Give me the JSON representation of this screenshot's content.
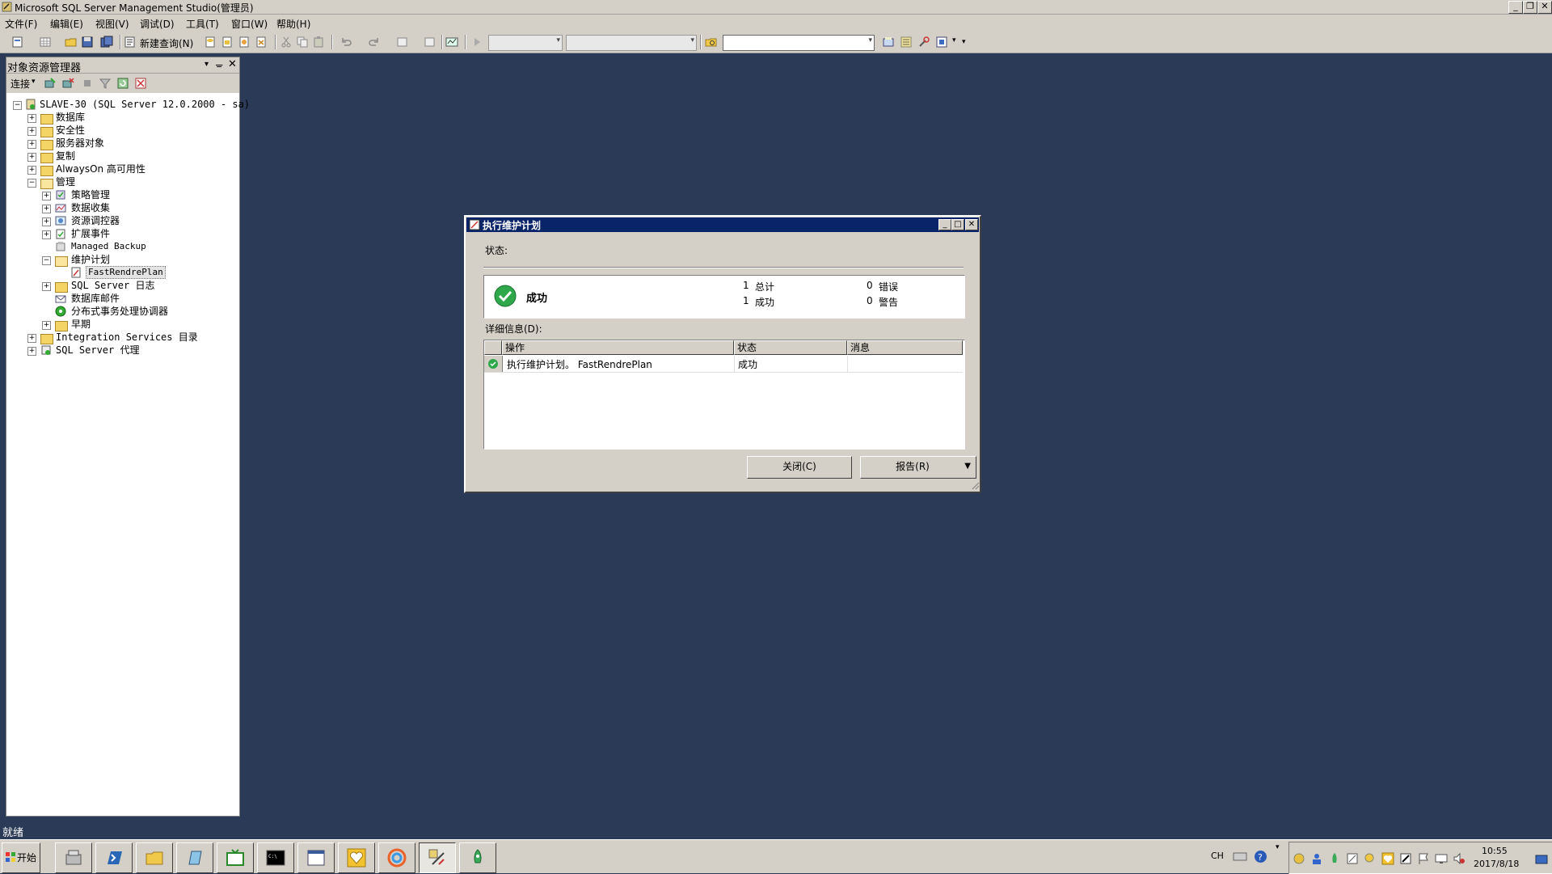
{
  "window": {
    "title": "Microsoft SQL Server Management Studio(管理员)"
  },
  "menu": [
    "文件(F)",
    "编辑(E)",
    "视图(V)",
    "调试(D)",
    "工具(T)",
    "窗口(W)",
    "帮助(H)"
  ],
  "toolbar": {
    "new_query": "新建查询(N)"
  },
  "object_explorer": {
    "title": "对象资源管理器",
    "connect": "连接",
    "server": "SLAVE-30 (SQL Server 12.0.2000 - sa)",
    "nodes": {
      "databases": "数据库",
      "security": "安全性",
      "server_objects": "服务器对象",
      "replication": "复制",
      "alwayson": "AlwaysOn 高可用性",
      "management": "管理",
      "policy": "策略管理",
      "data_collection": "数据收集",
      "resource_governor": "资源调控器",
      "extended_events": "扩展事件",
      "managed_backup": "Managed Backup",
      "maintenance_plans": "维护计划",
      "fastrendreplan": "FastRendrePlan",
      "sql_logs": "SQL Server 日志",
      "db_mail": "数据库邮件",
      "dtc": "分布式事务处理协调器",
      "legacy": "早期",
      "integration_services": "Integration Services 目录",
      "sql_agent": "SQL Server 代理"
    }
  },
  "status_bar": {
    "text": "就绪"
  },
  "dialog": {
    "title": "执行维护计划",
    "status_label": "状态:",
    "result_text": "成功",
    "summary": {
      "total_count": "1",
      "total_label": "总计",
      "success_count": "1",
      "success_label": "成功",
      "error_count": "0",
      "error_label": "错误",
      "warning_count": "0",
      "warning_label": "警告"
    },
    "details_label": "详细信息(D):",
    "columns": [
      "操作",
      "状态",
      "消息"
    ],
    "rows": [
      {
        "action": "执行维护计划。 FastRendrePlan",
        "status": "成功",
        "message": ""
      }
    ],
    "close_button": "关闭(C)",
    "report_button": "报告(R)"
  },
  "tray": {
    "lang": "CH",
    "time": "10:55",
    "date": "2017/8/18"
  },
  "start_button": "开始"
}
